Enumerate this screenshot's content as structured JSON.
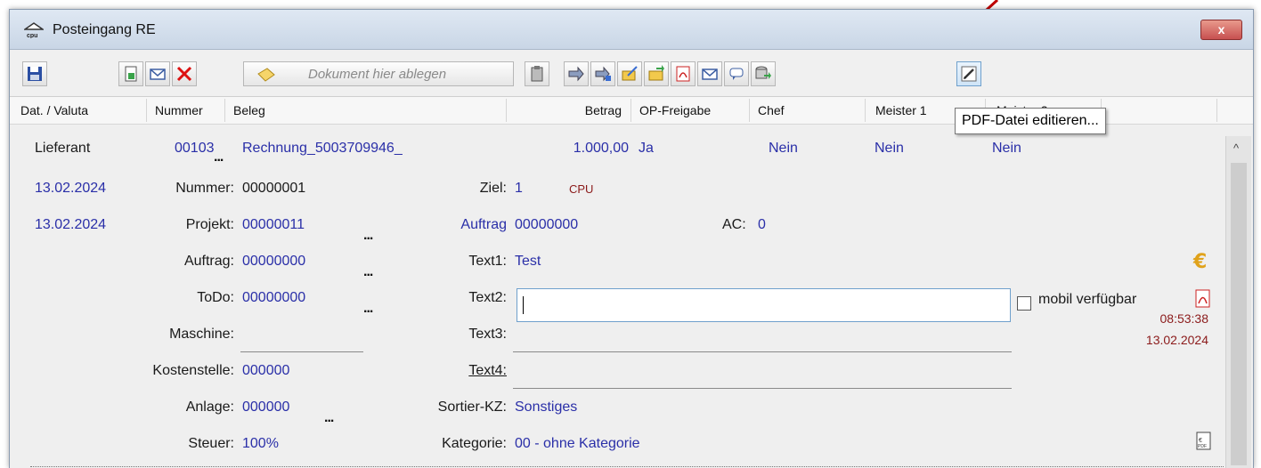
{
  "window": {
    "title": "Posteingang RE",
    "close_label": "x"
  },
  "toolbar": {
    "save_icon": "floppy-disk-icon",
    "drop_zone_label": "Dokument hier ablegen",
    "edit_pdf_icon": "edit-pdf-icon"
  },
  "columns": [
    "Dat. / Valuta",
    "Nummer",
    "Beleg",
    "Betrag",
    "OP-Freigabe",
    "Chef",
    "Meister 1",
    "Meister 2"
  ],
  "tooltip": "PDF-Datei editieren...",
  "record": {
    "row1": {
      "type": "Lieferant",
      "number": "00103",
      "beleg": "Rechnung_5003709946_",
      "betrag": "1.000,00",
      "op_freigabe": "Ja",
      "chef": "Nein",
      "meister1": "Nein",
      "meister2": "Nein"
    },
    "dat": "13.02.2024",
    "valuta": "13.02.2024",
    "fields": {
      "nummer_label": "Nummer:",
      "nummer": "00000001",
      "projekt_label": "Projekt:",
      "projekt": "00000011",
      "auftrag_label": "Auftrag:",
      "auftrag": "00000000",
      "todo_label": "ToDo:",
      "todo": "00000000",
      "maschine_label": "Maschine:",
      "maschine": "",
      "kostenstelle_label": "Kostenstelle:",
      "kostenstelle": "000000",
      "anlage_label": "Anlage:",
      "anlage": "000000",
      "steuer_label": "Steuer:",
      "steuer": "100%"
    },
    "mid": {
      "ziel_label": "Ziel:",
      "ziel": "1",
      "cpu": "CPU",
      "auftrag2_label": "Auftrag",
      "auftrag2": "00000000",
      "ac_label": "AC:",
      "ac": "0",
      "text1_label": "Text1:",
      "text1": "Test",
      "text2_label": "Text2:",
      "text2": "",
      "text3_label": "Text3:",
      "text3": "",
      "text4_label": "Text4:",
      "text4": "",
      "sortier_label": "Sortier-KZ:",
      "sortier": "Sonstiges",
      "kategorie_label": "Kategorie:",
      "kategorie": "00 - ohne Kategorie"
    },
    "mobil_label": "mobil verfügbar",
    "time": "08:53:38",
    "date": "13.02.2024"
  },
  "colors": {
    "link_blue": "#2a2fa8",
    "dark_red": "#8b1a1a",
    "annotation_arrow": "#c00000"
  }
}
